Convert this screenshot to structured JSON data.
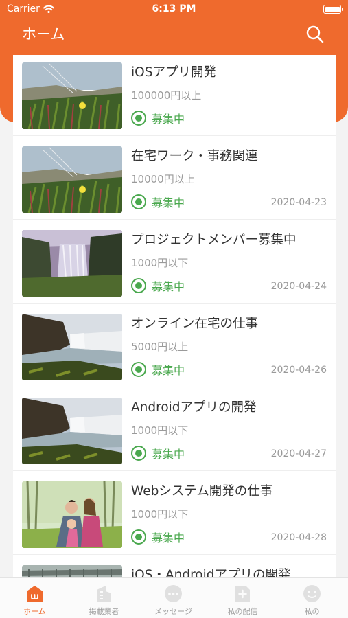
{
  "status_bar": {
    "carrier": "Carrier",
    "time": "6:13 PM"
  },
  "header": {
    "title": "ホーム"
  },
  "colors": {
    "accent": "#ef6a2d",
    "recruiting": "#4aa84e"
  },
  "list": [
    {
      "title": "iOSアプリ開発",
      "price": "100000円以上",
      "status": "募集中",
      "date": "",
      "image": "flower-field"
    },
    {
      "title": "在宅ワーク・事務関連",
      "price": "10000円以上",
      "status": "募集中",
      "date": "2020-04-23",
      "image": "flower-field"
    },
    {
      "title": "プロジェクトメンバー募集中",
      "price": "1000円以下",
      "status": "募集中",
      "date": "2020-04-24",
      "image": "waterfall-cliff"
    },
    {
      "title": "オンライン在宅の仕事",
      "price": "5000円以上",
      "status": "募集中",
      "date": "2020-04-26",
      "image": "waterfall-coast"
    },
    {
      "title": "Androidアプリの開発",
      "price": "1000円以下",
      "status": "募集中",
      "date": "2020-04-27",
      "image": "waterfall-coast"
    },
    {
      "title": "Webシステム開発の仕事",
      "price": "1000円以下",
      "status": "募集中",
      "date": "2020-04-28",
      "image": "family-photo"
    },
    {
      "title": "iOS・Androidアプリの開発",
      "price": "",
      "status": "",
      "date": "",
      "image": "bridge"
    }
  ],
  "tabs": [
    {
      "label": "ホーム",
      "icon": "home-icon",
      "active": true
    },
    {
      "label": "掲載業者",
      "icon": "building-icon",
      "active": false
    },
    {
      "label": "メッセージ",
      "icon": "message-icon",
      "active": false
    },
    {
      "label": "私の配信",
      "icon": "add-post-icon",
      "active": false
    },
    {
      "label": "私の",
      "icon": "profile-icon",
      "active": false
    }
  ]
}
